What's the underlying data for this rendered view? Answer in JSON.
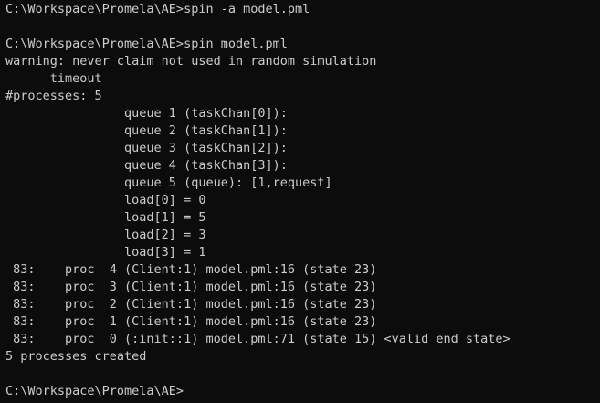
{
  "terminal": {
    "lines": [
      "C:\\Workspace\\Promela\\AE>spin -a model.pml",
      "",
      "C:\\Workspace\\Promela\\AE>spin model.pml",
      "warning: never claim not used in random simulation",
      "      timeout",
      "#processes: 5",
      "                queue 1 (taskChan[0]):",
      "                queue 2 (taskChan[1]):",
      "                queue 3 (taskChan[2]):",
      "                queue 4 (taskChan[3]):",
      "                queue 5 (queue): [1,request]",
      "                load[0] = 0",
      "                load[1] = 5",
      "                load[2] = 3",
      "                load[3] = 1",
      " 83:    proc  4 (Client:1) model.pml:16 (state 23)",
      " 83:    proc  3 (Client:1) model.pml:16 (state 23)",
      " 83:    proc  2 (Client:1) model.pml:16 (state 23)",
      " 83:    proc  1 (Client:1) model.pml:16 (state 23)",
      " 83:    proc  0 (:init::1) model.pml:71 (state 15) <valid end state>",
      "5 processes created",
      "",
      "C:\\Workspace\\Promela\\AE>"
    ],
    "foreground": "#cccccc",
    "background": "#0c0c0c"
  }
}
